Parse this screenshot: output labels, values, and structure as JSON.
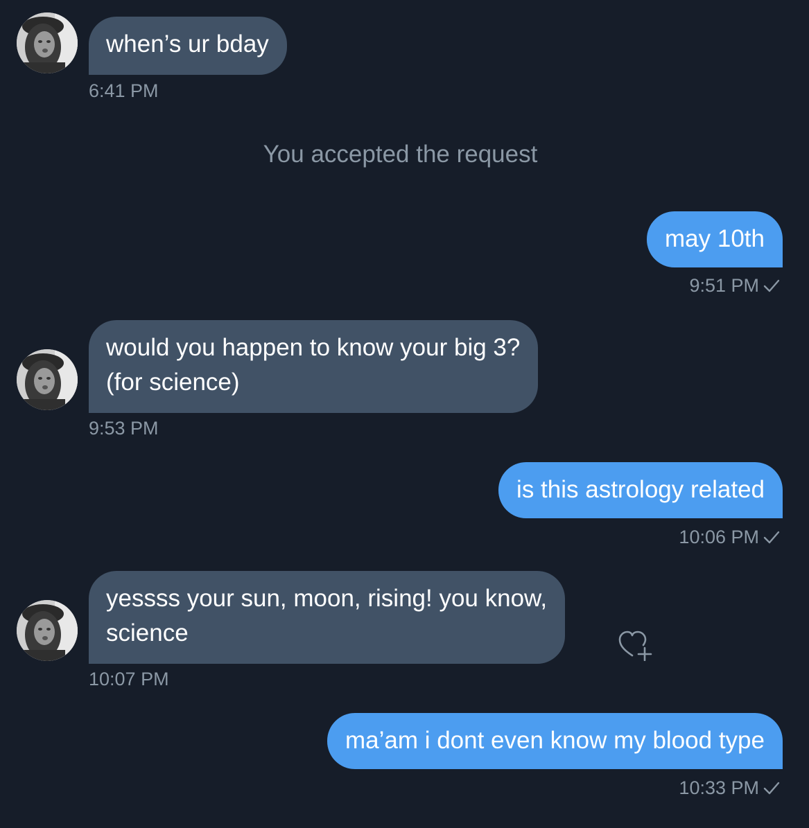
{
  "system_message": "You accepted the request",
  "messages": [
    {
      "direction": "in",
      "text": "when’s ur bday",
      "time": "6:41 PM"
    },
    {
      "direction": "out",
      "text": "may 10th",
      "time": "9:51 PM",
      "receipt_icon": "check-icon"
    },
    {
      "direction": "in",
      "lines": [
        "would you happen to know your big 3?",
        "(for science)"
      ],
      "time": "9:53 PM"
    },
    {
      "direction": "out",
      "text": "is this astrology related",
      "time": "10:06 PM",
      "receipt_icon": "check-icon"
    },
    {
      "direction": "in",
      "lines": [
        "yessss your sun, moon, rising! you know,",
        "science"
      ],
      "time": "10:07 PM",
      "action_icon": "heart-plus-icon"
    },
    {
      "direction": "out",
      "text": "ma’am i dont even know my blood type",
      "time": "10:33 PM",
      "receipt_icon": "check-icon"
    }
  ],
  "colors": {
    "background": "#161d29",
    "incoming_bubble": "#415266",
    "outgoing_bubble": "#4c9df0",
    "meta_text": "#8b98a5"
  }
}
